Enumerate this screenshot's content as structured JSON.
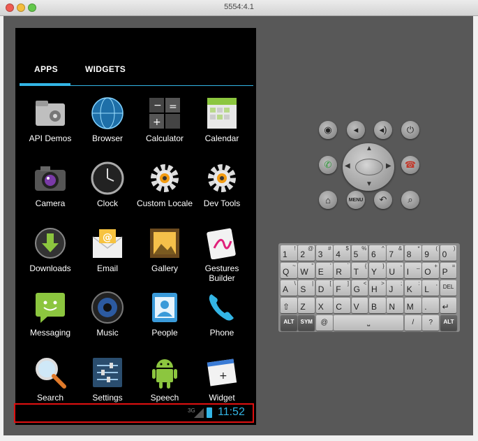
{
  "window": {
    "title": "5554:4.1"
  },
  "tabs": {
    "apps": "APPS",
    "widgets": "WIDGETS"
  },
  "apps": [
    {
      "label": "API Demos",
      "icon": "folder-gear-icon"
    },
    {
      "label": "Browser",
      "icon": "globe-icon"
    },
    {
      "label": "Calculator",
      "icon": "calculator-icon"
    },
    {
      "label": "Calendar",
      "icon": "calendar-icon"
    },
    {
      "label": "Camera",
      "icon": "camera-icon"
    },
    {
      "label": "Clock",
      "icon": "clock-icon"
    },
    {
      "label": "Custom Locale",
      "icon": "gear-icon"
    },
    {
      "label": "Dev Tools",
      "icon": "gear-icon"
    },
    {
      "label": "Downloads",
      "icon": "download-icon"
    },
    {
      "label": "Email",
      "icon": "email-icon"
    },
    {
      "label": "Gallery",
      "icon": "gallery-icon"
    },
    {
      "label": "Gestures Builder",
      "icon": "gestures-icon"
    },
    {
      "label": "Messaging",
      "icon": "message-icon"
    },
    {
      "label": "Music",
      "icon": "music-icon"
    },
    {
      "label": "People",
      "icon": "contacts-icon"
    },
    {
      "label": "Phone",
      "icon": "phone-icon"
    },
    {
      "label": "Search",
      "icon": "magnifier-icon"
    },
    {
      "label": "Settings",
      "icon": "sliders-icon"
    },
    {
      "label": "Speech",
      "icon": "android-icon"
    },
    {
      "label": "Widget",
      "icon": "widget-icon"
    }
  ],
  "status": {
    "network": "3G",
    "time": "11:52"
  },
  "keyboard": {
    "row1": [
      [
        "1",
        "!"
      ],
      [
        "2",
        "@"
      ],
      [
        "3",
        "#"
      ],
      [
        "4",
        "$"
      ],
      [
        "5",
        "%"
      ],
      [
        "6",
        "^"
      ],
      [
        "7",
        "&"
      ],
      [
        "8",
        "*"
      ],
      [
        "9",
        "("
      ],
      [
        "0",
        ")"
      ]
    ],
    "row2": [
      [
        "Q",
        "~"
      ],
      [
        "W",
        "\""
      ],
      [
        "E",
        "'"
      ],
      [
        "R",
        "`"
      ],
      [
        "T",
        "{"
      ],
      [
        "Y",
        "}"
      ],
      [
        "U",
        "-"
      ],
      [
        "I",
        "_"
      ],
      [
        "O",
        "+"
      ],
      [
        "P",
        "="
      ]
    ],
    "row3": [
      [
        "A",
        "\\"
      ],
      [
        "S",
        "|"
      ],
      [
        "D",
        "["
      ],
      [
        "F",
        "]"
      ],
      [
        "G",
        "<"
      ],
      [
        "H",
        ">"
      ],
      [
        "J",
        ";"
      ],
      [
        "K",
        ":"
      ],
      [
        "L",
        ","
      ],
      [
        "DEL",
        ""
      ]
    ],
    "row4": [
      [
        "⇧",
        ""
      ],
      [
        "Z",
        ""
      ],
      [
        "X",
        ""
      ],
      [
        "C",
        ""
      ],
      [
        "V",
        ""
      ],
      [
        "B",
        ""
      ],
      [
        "N",
        ""
      ],
      [
        "M",
        ""
      ],
      [
        ".",
        ""
      ],
      [
        "↵",
        ""
      ]
    ],
    "row5": {
      "alt": "ALT",
      "sym": "SYM",
      "at": "@",
      "slash": "/",
      "question": "?",
      "alt2": "ALT"
    }
  }
}
